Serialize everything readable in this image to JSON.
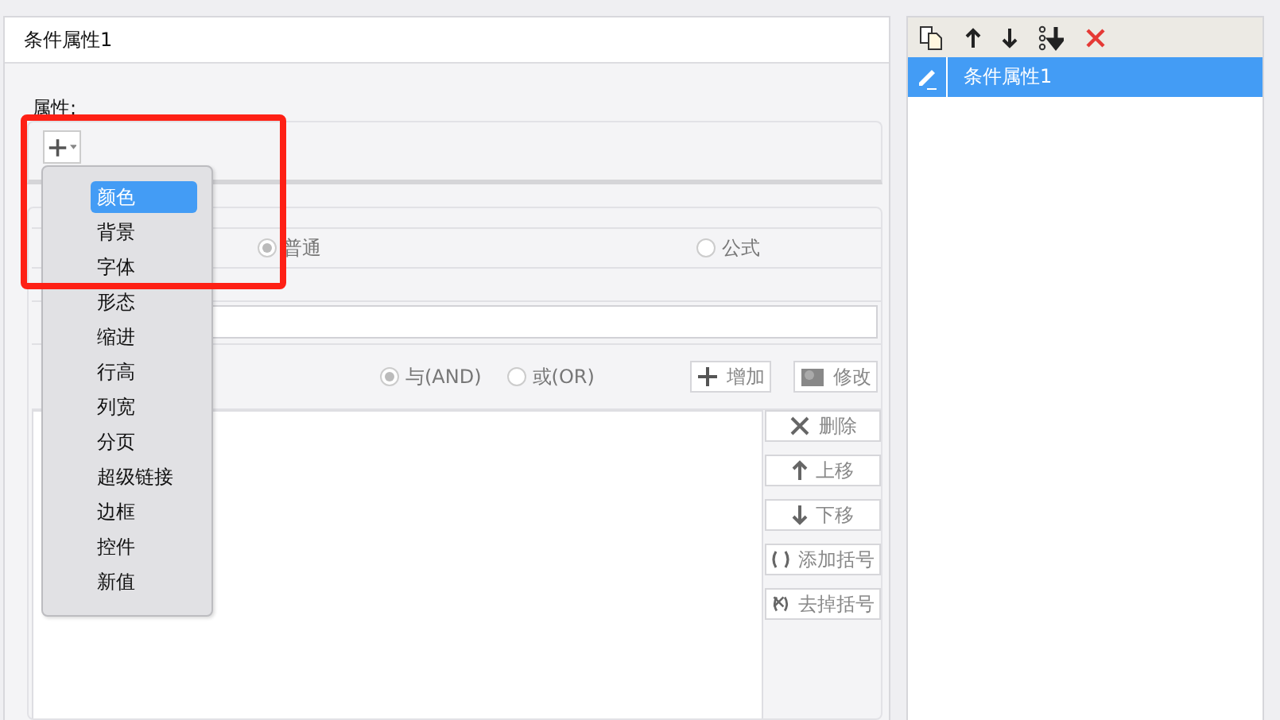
{
  "editor": {
    "title": "条件属性1",
    "property_label": "属性:",
    "type_options": [
      {
        "label": "普通",
        "selected": true
      },
      {
        "label": "公式",
        "selected": false
      }
    ],
    "logic_options": [
      {
        "label": "与(AND)",
        "selected": true
      },
      {
        "label": "或(OR)",
        "selected": false
      }
    ],
    "top_buttons": [
      {
        "label": "增加"
      },
      {
        "label": "修改"
      }
    ],
    "side_buttons": [
      {
        "label": "删除"
      },
      {
        "label": "上移"
      },
      {
        "label": "下移"
      },
      {
        "label": "添加括号"
      },
      {
        "label": "去掉括号"
      }
    ]
  },
  "add_menu": {
    "items": [
      {
        "label": "颜色",
        "selected": true
      },
      {
        "label": "背景",
        "selected": false
      },
      {
        "label": "字体",
        "selected": false
      },
      {
        "label": "形态",
        "selected": false
      },
      {
        "label": "缩进",
        "selected": false
      },
      {
        "label": "行高",
        "selected": false
      },
      {
        "label": "列宽",
        "selected": false
      },
      {
        "label": "分页",
        "selected": false
      },
      {
        "label": "超级链接",
        "selected": false
      },
      {
        "label": "边框",
        "selected": false
      },
      {
        "label": "控件",
        "selected": false
      },
      {
        "label": "新值",
        "selected": false
      }
    ]
  },
  "condition_list": {
    "items": [
      {
        "label": "条件属性1",
        "selected": true
      }
    ]
  }
}
